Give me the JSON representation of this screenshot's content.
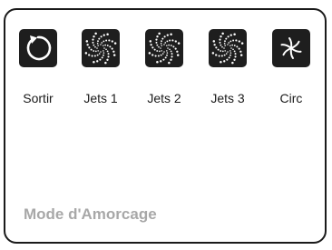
{
  "buttons": [
    {
      "label": "Sortir",
      "icon": "back-arrow-icon"
    },
    {
      "label": "Jets 1",
      "icon": "jets-swirl-icon"
    },
    {
      "label": "Jets 2",
      "icon": "jets-swirl-icon"
    },
    {
      "label": "Jets 3",
      "icon": "jets-swirl-icon"
    },
    {
      "label": "Circ",
      "icon": "circ-pump-icon"
    }
  ],
  "status": {
    "mode_text": "Mode d'Amorcage"
  },
  "colors": {
    "button_bg": "#1e1e1e",
    "icon_fg": "#ffffff",
    "status_text": "#a8a8a8",
    "frame_border": "#1a1a1a"
  }
}
